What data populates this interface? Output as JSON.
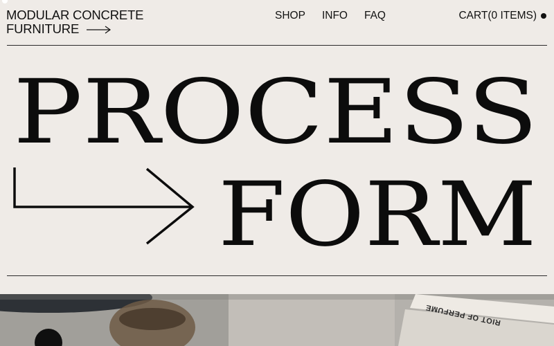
{
  "header": {
    "brand_line1": "MODULAR CONCRETE",
    "brand_line2": "FURNITURE",
    "brand_icon": "arrow-right-icon",
    "nav": [
      {
        "label": "SHOP"
      },
      {
        "label": "INFO"
      },
      {
        "label": "FAQ"
      }
    ],
    "cart_label": "CART(0 ITEMS)",
    "cart_icon": "cart-dot-icon"
  },
  "hero": {
    "line1": "PROCESS",
    "line2": "FORM",
    "connector_icon": "corner-arrow-icon"
  },
  "photo": {
    "label_text": "RIOT OF PERFUME"
  },
  "colors": {
    "background": "#efebe7",
    "text": "#111111"
  }
}
